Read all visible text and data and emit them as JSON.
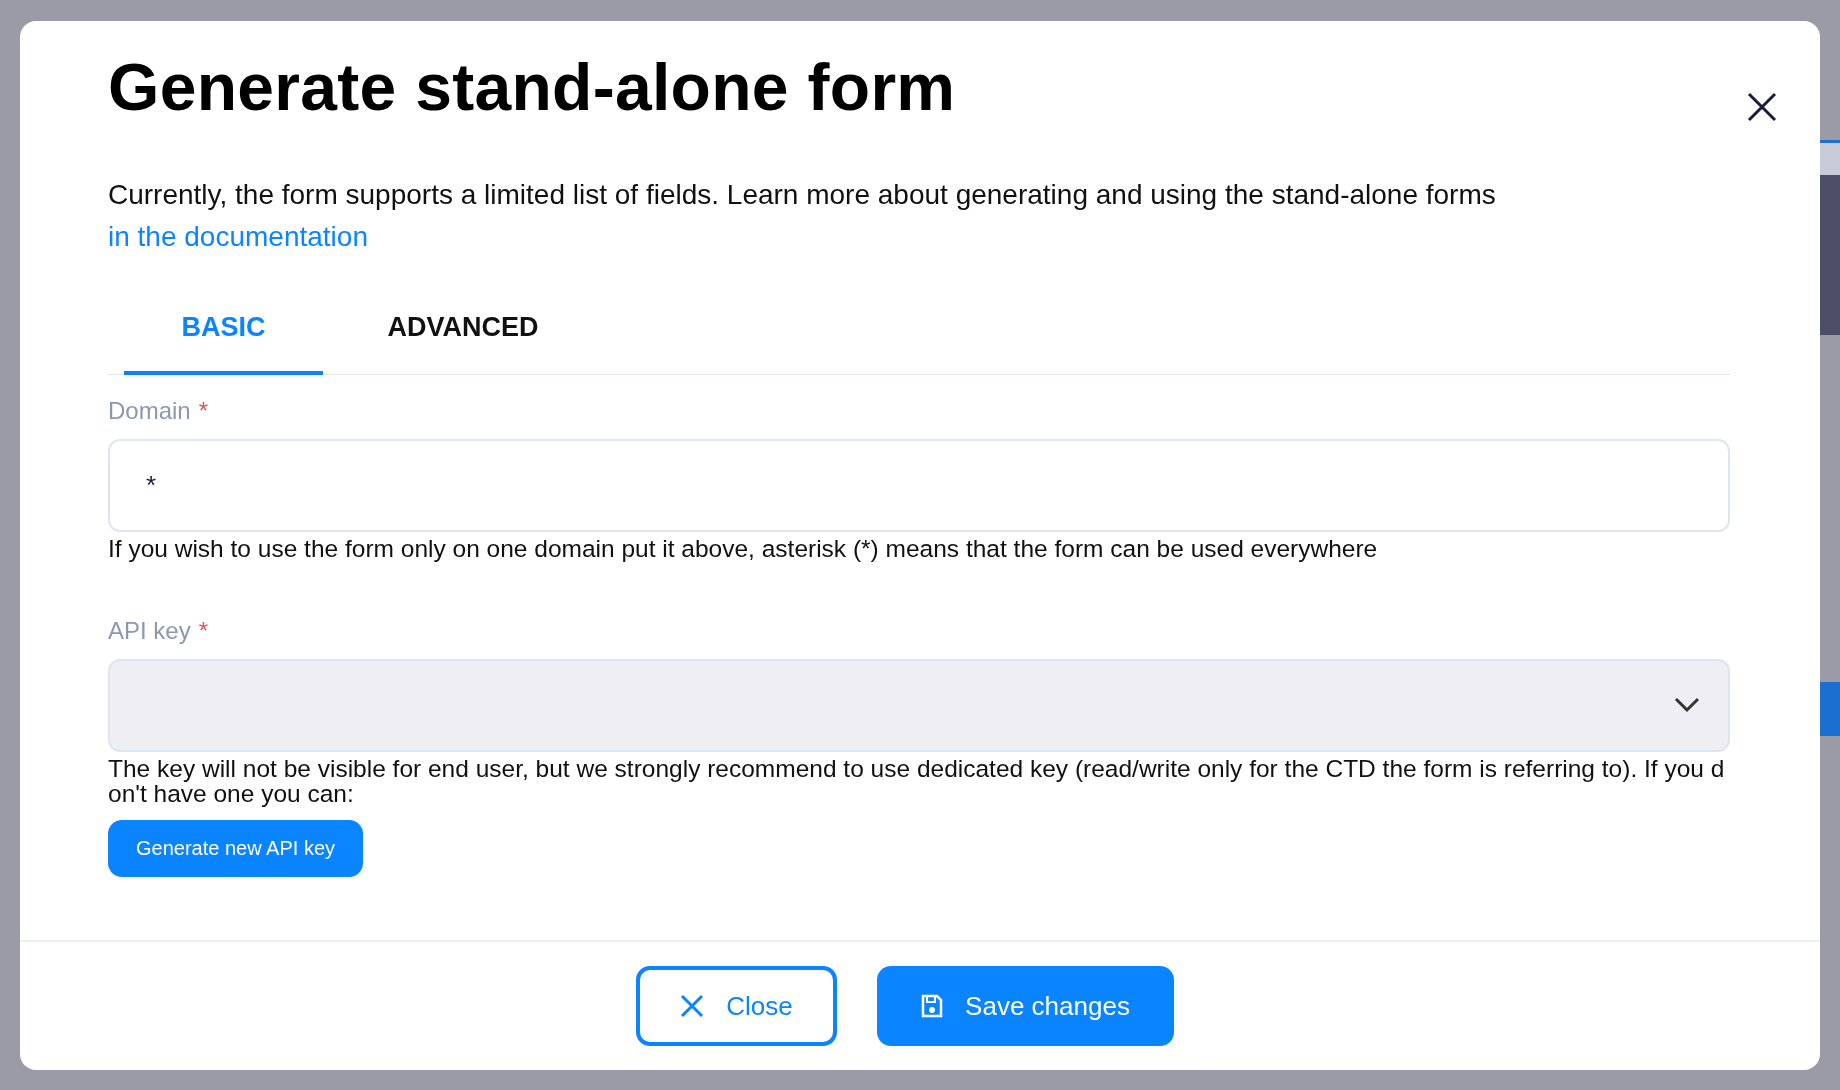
{
  "dialog": {
    "title": "Generate stand-alone form",
    "description": "Currently, the form supports a limited list of fields. Learn more about generating and using the stand-alone forms",
    "link": "in the documentation",
    "tabs": [
      {
        "label": "BASIC",
        "selected": true
      },
      {
        "label": "ADVANCED",
        "selected": false
      }
    ],
    "fields": [
      {
        "kind": "text",
        "label": "Domain",
        "required": true,
        "value": "*",
        "help": "If you wish to use the form only on one domain put it above, asterisk (*) means that the form can be used everywhere"
      },
      {
        "kind": "select",
        "label": "API key",
        "required": true,
        "help": "The key will not be visible for end user, but we strongly recommend to use dedicated key (read/write only for the CTD the form is referring to). If you don't have one you can:",
        "action": "Generate new API key"
      }
    ],
    "buttons": [
      {
        "kind": "close",
        "label": "Close"
      },
      {
        "kind": "save",
        "label": "Save changes"
      }
    ]
  }
}
